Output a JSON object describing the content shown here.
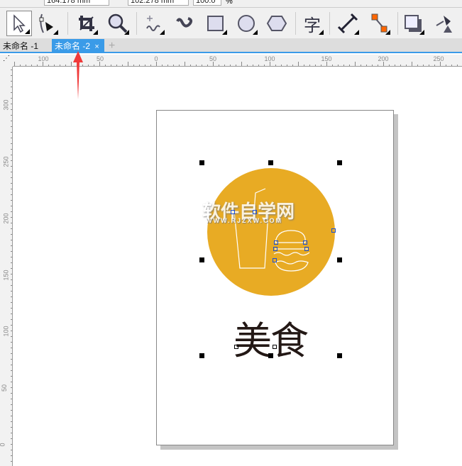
{
  "property_bar": {
    "y_value": "164.178 mm",
    "h_value": "102.278 mm",
    "scale_value": "100.0",
    "scale_unit": "%"
  },
  "tabs": [
    {
      "label": "未命名 -1"
    },
    {
      "label": "未命名 -2",
      "close": "×"
    }
  ],
  "add_tab": "+",
  "tools": [
    "pick-tool",
    "shape-tool",
    "crop-tool",
    "zoom-tool",
    "freehand-tool",
    "artistic-media-tool",
    "rectangle-tool",
    "ellipse-tool",
    "polygon-tool",
    "text-tool",
    "dimension-tool",
    "connector-tool",
    "drop-shadow-tool",
    "fill-tool"
  ],
  "text_tool_glyph": "字",
  "hruler": [
    {
      "v": "100",
      "p": 61
    },
    {
      "v": "50",
      "p": 141
    },
    {
      "v": "0",
      "p": 220
    },
    {
      "v": "50",
      "p": 300
    },
    {
      "v": "100",
      "p": 380
    },
    {
      "v": "150",
      "p": 460
    },
    {
      "v": "200",
      "p": 540
    },
    {
      "v": "250",
      "p": 618
    }
  ],
  "vruler": [
    "300",
    "250",
    "200",
    "150",
    "100",
    "50",
    "0"
  ],
  "canvas": {
    "title": "美食",
    "watermark": "软件自学网",
    "watermark_url": "WWW.RJZXW.COM",
    "circle_color": "#e8ab24",
    "text_color": "#231815"
  },
  "annotation_color": "#f03a3a"
}
